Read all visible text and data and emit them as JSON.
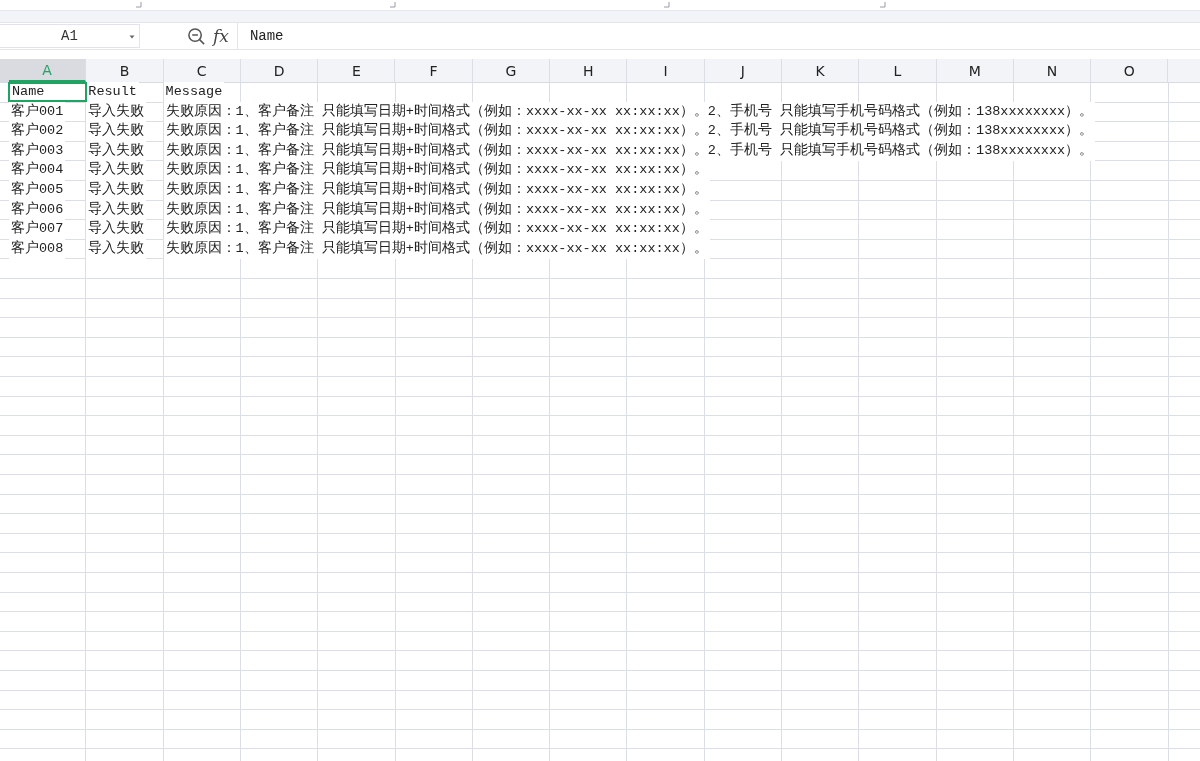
{
  "name_box": {
    "value": "A1"
  },
  "formula_bar": {
    "function_label": "fx",
    "value": "Name"
  },
  "columns": [
    {
      "label": "A",
      "selected": true
    },
    {
      "label": "B",
      "selected": false
    },
    {
      "label": "C",
      "selected": false
    },
    {
      "label": "D",
      "selected": false
    },
    {
      "label": "E",
      "selected": false
    },
    {
      "label": "F",
      "selected": false
    },
    {
      "label": "G",
      "selected": false
    },
    {
      "label": "H",
      "selected": false
    },
    {
      "label": "I",
      "selected": false
    },
    {
      "label": "J",
      "selected": false
    },
    {
      "label": "K",
      "selected": false
    },
    {
      "label": "L",
      "selected": false
    },
    {
      "label": "M",
      "selected": false
    },
    {
      "label": "N",
      "selected": false
    },
    {
      "label": "O",
      "selected": false
    }
  ],
  "rows": [
    {
      "cells": [
        {
          "text": "Name",
          "selected": true
        },
        {
          "text": "Result",
          "selected": false
        },
        {
          "text": "Message",
          "selected": false
        }
      ]
    },
    {
      "cells": [
        {
          "text": "客户001",
          "selected": false
        },
        {
          "text": "导入失败",
          "selected": false
        },
        {
          "text": "失败原因：1、客户备注 只能填写日期+时间格式（例如：xxxx-xx-xx xx:xx:xx）。2、手机号 只能填写手机号码格式（例如：138xxxxxxxx）。",
          "selected": false
        }
      ]
    },
    {
      "cells": [
        {
          "text": "客户002",
          "selected": false
        },
        {
          "text": "导入失败",
          "selected": false
        },
        {
          "text": "失败原因：1、客户备注 只能填写日期+时间格式（例如：xxxx-xx-xx xx:xx:xx）。2、手机号 只能填写手机号码格式（例如：138xxxxxxxx）。",
          "selected": false
        }
      ]
    },
    {
      "cells": [
        {
          "text": "客户003",
          "selected": false
        },
        {
          "text": "导入失败",
          "selected": false
        },
        {
          "text": "失败原因：1、客户备注 只能填写日期+时间格式（例如：xxxx-xx-xx xx:xx:xx）。2、手机号 只能填写手机号码格式（例如：138xxxxxxxx）。",
          "selected": false
        }
      ]
    },
    {
      "cells": [
        {
          "text": "客户004",
          "selected": false
        },
        {
          "text": "导入失败",
          "selected": false
        },
        {
          "text": "失败原因：1、客户备注 只能填写日期+时间格式（例如：xxxx-xx-xx xx:xx:xx）。",
          "selected": false
        }
      ]
    },
    {
      "cells": [
        {
          "text": "客户005",
          "selected": false
        },
        {
          "text": "导入失败",
          "selected": false
        },
        {
          "text": "失败原因：1、客户备注 只能填写日期+时间格式（例如：xxxx-xx-xx xx:xx:xx）。",
          "selected": false
        }
      ]
    },
    {
      "cells": [
        {
          "text": "客户006",
          "selected": false
        },
        {
          "text": "导入失败",
          "selected": false
        },
        {
          "text": "失败原因：1、客户备注 只能填写日期+时间格式（例如：xxxx-xx-xx xx:xx:xx）。",
          "selected": false
        }
      ]
    },
    {
      "cells": [
        {
          "text": "客户007",
          "selected": false
        },
        {
          "text": "导入失败",
          "selected": false
        },
        {
          "text": "失败原因：1、客户备注 只能填写日期+时间格式（例如：xxxx-xx-xx xx:xx:xx）。",
          "selected": false
        }
      ]
    },
    {
      "cells": [
        {
          "text": "客户008",
          "selected": false
        },
        {
          "text": "导入失败",
          "selected": false
        },
        {
          "text": "失败原因：1、客户备注 只能填写日期+时间格式（例如：xxxx-xx-xx xx:xx:xx）。",
          "selected": false
        }
      ]
    }
  ]
}
